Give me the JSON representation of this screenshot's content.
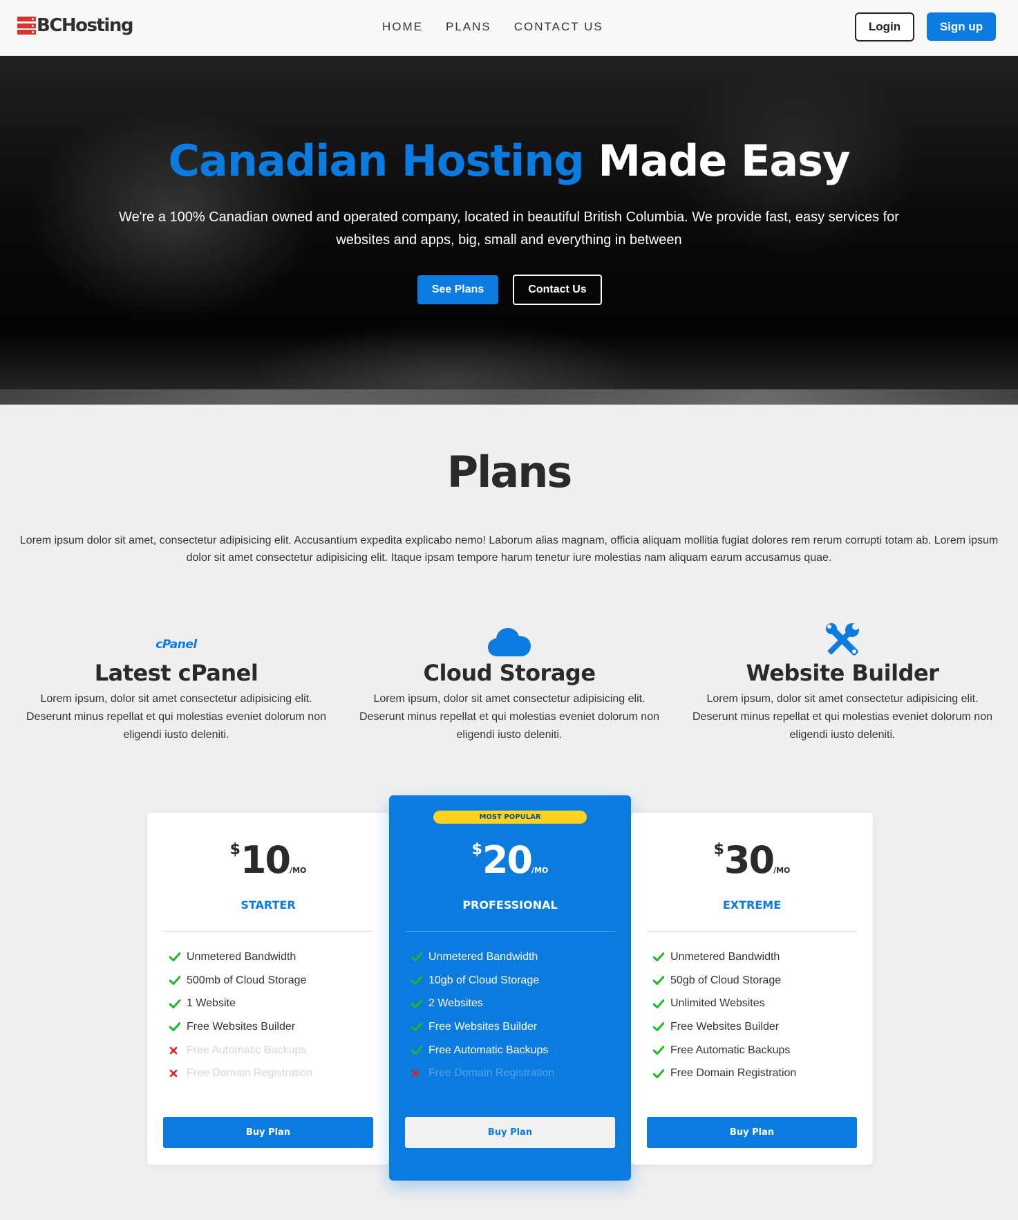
{
  "nav": {
    "brand": "BCHosting",
    "links": [
      "HOME",
      "PLANS",
      "CONTACT US"
    ],
    "login_label": "Login",
    "signup_label": "Sign up"
  },
  "hero": {
    "title_accent": "Canadian Hosting",
    "title_rest": " Made Easy",
    "text": "We're a 100% Canadian owned and operated company, located in beautiful British Columbia. We provide fast, easy services for websites and apps, big, small and everything in between",
    "see_plans_label": "See Plans",
    "contact_label": "Contact Us"
  },
  "plans": {
    "heading": "Plans",
    "intro": "Lorem ipsum dolor sit amet, consectetur adipisicing elit. Accusantium expedita explicabo nemo! Laborum alias magnam, officia aliquam mollitia fugiat dolores rem rerum corrupti totam ab. Lorem ipsum dolor sit amet consectetur adipisicing elit. Itaque ipsam tempore harum tenetur iure molestias nam aliquam earum accusamus quae.",
    "features": [
      {
        "icon": "cpanel-logo",
        "logo_text": "cPanel",
        "title": "Latest cPanel",
        "text": "Lorem ipsum, dolor sit amet consectetur adipisicing elit. Deserunt minus repellat et qui molestias eveniet dolorum non eligendi iusto deleniti."
      },
      {
        "icon": "cloud-icon",
        "title": "Cloud Storage",
        "text": "Lorem ipsum, dolor sit amet consectetur adipisicing elit. Deserunt minus repellat et qui molestias eveniet dolorum non eligendi iusto deleniti."
      },
      {
        "icon": "tools-icon",
        "title": "Website Builder",
        "text": "Lorem ipsum, dolor sit amet consectetur adipisicing elit. Deserunt minus repellat et qui molestias eveniet dolorum non eligendi iusto deleniti."
      }
    ]
  },
  "pricing": [
    {
      "currency": "$",
      "amount": "10",
      "period": "/MO",
      "name": "STARTER",
      "button": "Buy Plan",
      "features": [
        {
          "text": "Unmetered Bandwidth",
          "included": true
        },
        {
          "text": "500mb of Cloud Storage",
          "included": true
        },
        {
          "text": "1 Website",
          "included": true
        },
        {
          "text": "Free Websites Builder",
          "included": true
        },
        {
          "text": "Free Automatic Backups",
          "included": false
        },
        {
          "text": "Free Domain Registration",
          "included": false
        }
      ]
    },
    {
      "badge": "MOST POPULAR",
      "currency": "$",
      "amount": "20",
      "period": "/MO",
      "name": "PROFESSIONAL",
      "button": "Buy Plan",
      "features": [
        {
          "text": "Unmetered Bandwidth",
          "included": true
        },
        {
          "text": "10gb of Cloud Storage",
          "included": true
        },
        {
          "text": "2 Websites",
          "included": true
        },
        {
          "text": "Free Websites Builder",
          "included": true
        },
        {
          "text": "Free Automatic Backups",
          "included": true
        },
        {
          "text": "Free Domain Registration",
          "included": false
        }
      ]
    },
    {
      "currency": "$",
      "amount": "30",
      "period": "/MO",
      "name": "EXTREME",
      "button": "Buy Plan",
      "features": [
        {
          "text": "Unmetered Bandwidth",
          "included": true
        },
        {
          "text": "50gb of Cloud Storage",
          "included": true
        },
        {
          "text": "Unlimited Websites",
          "included": true
        },
        {
          "text": "Free Websites Builder",
          "included": true
        },
        {
          "text": "Free Automatic Backups",
          "included": true
        },
        {
          "text": "Free Domain Registration",
          "included": true
        }
      ]
    }
  ],
  "colors": {
    "accent": "#0b7be0",
    "brand_red": "#d9342b",
    "check": "#1fb91f",
    "cross": "#e02020",
    "badge": "#ffd21f"
  }
}
